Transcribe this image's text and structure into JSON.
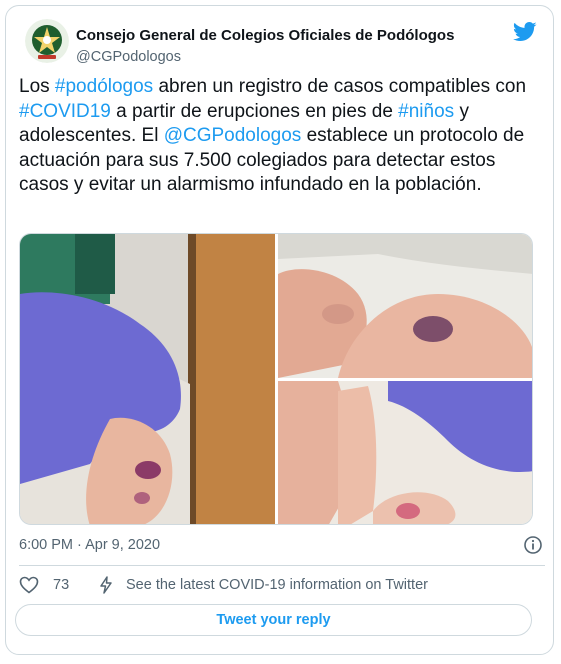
{
  "tweet": {
    "author_name": "Consejo General de Colegios Oficiales de Podólogos",
    "author_handle": "@CGPodologos",
    "text_segments": [
      {
        "t": "Los ",
        "hl": false
      },
      {
        "t": "#podólogos",
        "hl": true
      },
      {
        "t": " abren un registro de casos compatibles con ",
        "hl": false
      },
      {
        "t": "#COVID19",
        "hl": true
      },
      {
        "t": " a partir de erupciones en pies de ",
        "hl": false
      },
      {
        "t": "#niños",
        "hl": true
      },
      {
        "t": " y adolescentes. El ",
        "hl": false
      },
      {
        "t": "@CGPodologos",
        "hl": true
      },
      {
        "t": "  establece un protocolo de actuación para sus 7.500 colegiados para detectar estos casos y evitar un alarmismo infundado en la población.",
        "hl": false
      }
    ],
    "timestamp": "6:00 PM · Apr 9, 2020",
    "like_count": "73",
    "covid_info": "See the latest COVID-19 information on Twitter",
    "reply_label": "Tweet your reply"
  },
  "colors": {
    "link": "#1d9bf0",
    "muted": "#536471",
    "border": "#cfd9de"
  },
  "icons": [
    "twitter-bird-icon",
    "info-icon",
    "heart-icon",
    "lightning-icon"
  ]
}
